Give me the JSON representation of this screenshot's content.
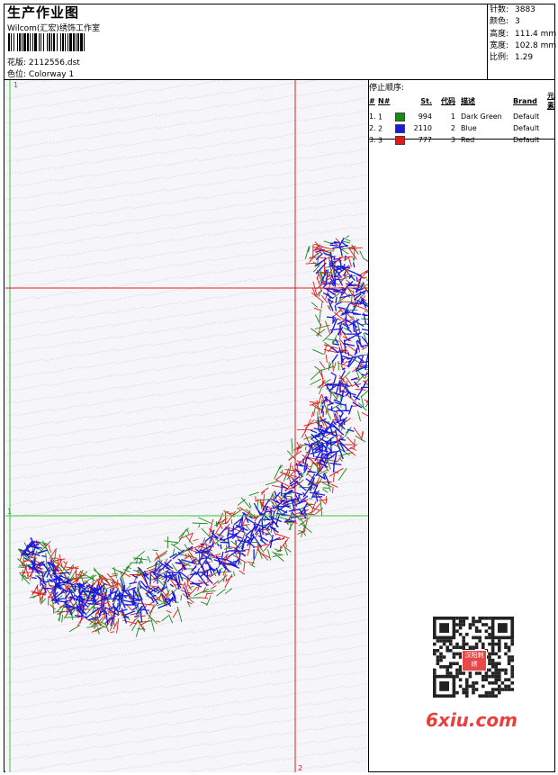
{
  "header": {
    "title": "生产作业图",
    "company": "Wilcom(汇宏)绣饰工作室",
    "design_label": "花版:",
    "design_value": "2112556.dst",
    "colorway_label": "色位:",
    "colorway_value": "Colorway 1"
  },
  "stats": {
    "stitches_label": "针数:",
    "stitches_value": "3883",
    "colors_label": "颜色:",
    "colors_value": "3",
    "height_label": "高度:",
    "height_value": "111.4 mm",
    "width_label": "宽度:",
    "width_value": "102.8 mm",
    "scale_label": "比例:",
    "scale_value": "1.29"
  },
  "stop_sequence": {
    "title": "停止顺序:",
    "columns": [
      "#",
      "N#",
      "St.",
      "代码",
      "描述",
      "Brand",
      "元素"
    ],
    "rows": [
      {
        "idx": "1.",
        "n": "1",
        "swatch": "#1a8a1a",
        "st": "994",
        "code": "1",
        "desc": "Dark Green",
        "brand": "Default"
      },
      {
        "idx": "2.",
        "n": "2",
        "swatch": "#1a1adf",
        "st": "2110",
        "code": "2",
        "desc": "Blue",
        "brand": "Default"
      },
      {
        "idx": "3.",
        "n": "3",
        "swatch": "#df1a1a",
        "st": "777",
        "code": "3",
        "desc": "Red",
        "brand": "Default"
      }
    ]
  },
  "guides": {
    "v1_label": "1",
    "h1_label": "1",
    "h2_label": "2",
    "v2_label": "2"
  },
  "watermark": {
    "text": "6xiu.com",
    "qr_badge": "汉阳刺绣"
  },
  "colors": {
    "green": "#1a8a1a",
    "blue": "#1a1adf",
    "red": "#df1a1a",
    "guide_green": "#33cc33",
    "guide_red": "#dd2222"
  }
}
